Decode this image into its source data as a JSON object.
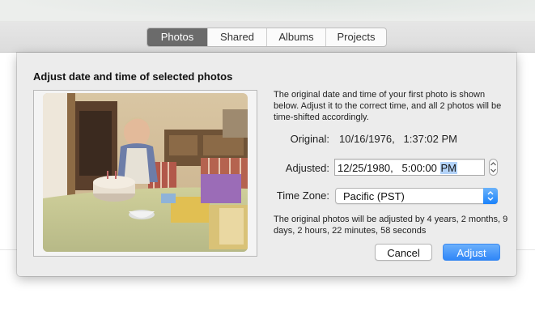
{
  "toolbar": {
    "tabs": [
      {
        "label": "Photos",
        "active": true
      },
      {
        "label": "Shared",
        "active": false
      },
      {
        "label": "Albums",
        "active": false
      },
      {
        "label": "Projects",
        "active": false
      }
    ]
  },
  "dialog": {
    "title": "Adjust date and time of selected photos",
    "intro": "The original date and time of your first photo is shown below. Adjust it to the correct time, and all 2 photos will be time-shifted accordingly.",
    "original_label": "Original:",
    "original_value": "10/16/1976,   1:37:02 PM",
    "adjusted_label": "Adjusted:",
    "adjusted_value": "12/25/1980,   5:00:00 ",
    "adjusted_selected": "PM",
    "timezone_label": "Time Zone:",
    "timezone_value": "Pacific (PST)",
    "note": "The original photos will be adjusted by 4 years, 2 months, 9 days, 2 hours, 22 minutes, 58 seconds",
    "cancel_label": "Cancel",
    "adjust_label": "Adjust"
  },
  "colors": {
    "accent": "#2f86f8",
    "selected_tab": "#6b6b6b",
    "selection": "#b3d3f9"
  },
  "icons": [
    "stepper-icon",
    "popup-chevron-icon"
  ]
}
